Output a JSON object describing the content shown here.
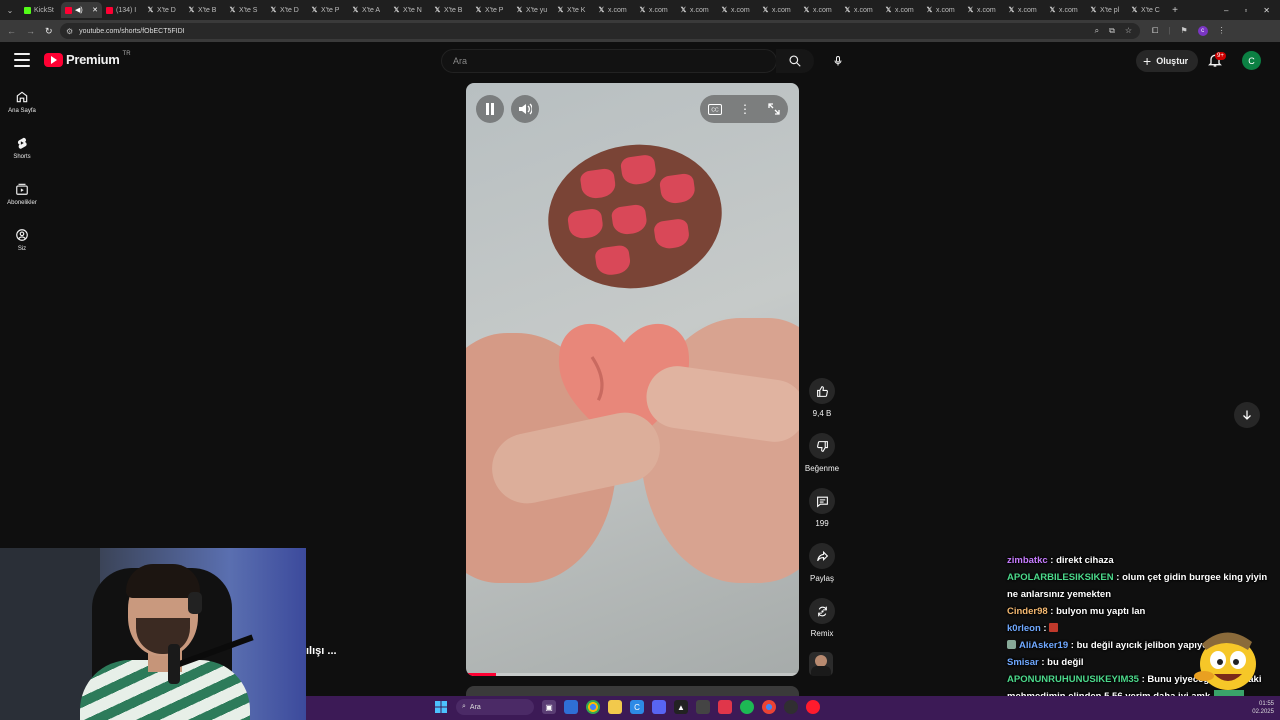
{
  "browser": {
    "tabs": [
      {
        "title": "KickSt",
        "icon": "kick",
        "active": false
      },
      {
        "title": "",
        "icon": "youtube",
        "active": true
      },
      {
        "title": "(134) I",
        "icon": "youtube",
        "active": false
      },
      {
        "title": "X'te D",
        "icon": "x",
        "active": false
      },
      {
        "title": "X'te B",
        "icon": "x",
        "active": false
      },
      {
        "title": "X'te S",
        "icon": "x",
        "active": false
      },
      {
        "title": "X'te D",
        "icon": "x",
        "active": false
      },
      {
        "title": "X'te P",
        "icon": "x",
        "active": false
      },
      {
        "title": "X'te A",
        "icon": "x",
        "active": false
      },
      {
        "title": "X'te N",
        "icon": "x",
        "active": false
      },
      {
        "title": "X'te B",
        "icon": "x",
        "active": false
      },
      {
        "title": "X'te P",
        "icon": "x",
        "active": false
      },
      {
        "title": "X'te yu",
        "icon": "x",
        "active": false
      },
      {
        "title": "X'te K",
        "icon": "x",
        "active": false
      },
      {
        "title": "x.com",
        "icon": "x",
        "active": false
      },
      {
        "title": "x.com",
        "icon": "x",
        "active": false
      },
      {
        "title": "x.com",
        "icon": "x",
        "active": false
      },
      {
        "title": "x.com",
        "icon": "x",
        "active": false
      },
      {
        "title": "x.com",
        "icon": "x",
        "active": false
      },
      {
        "title": "x.com",
        "icon": "x",
        "active": false
      },
      {
        "title": "x.com",
        "icon": "x",
        "active": false
      },
      {
        "title": "x.com",
        "icon": "x",
        "active": false
      },
      {
        "title": "x.com",
        "icon": "x",
        "active": false
      },
      {
        "title": "x.com",
        "icon": "x",
        "active": false
      },
      {
        "title": "x.com",
        "icon": "x",
        "active": false
      },
      {
        "title": "x.com",
        "icon": "x",
        "active": false
      },
      {
        "title": "X'te pl",
        "icon": "x",
        "active": false
      },
      {
        "title": "X'te C",
        "icon": "x",
        "active": false
      }
    ],
    "url": "youtube.com/shorts/fObECT5FIDI",
    "profile_initial": "c"
  },
  "header": {
    "logo_text": "Premium",
    "logo_region": "TR",
    "search_placeholder": "Ara",
    "create_label": "Oluştur",
    "notification_count": "9+",
    "avatar_initial": "C",
    "accent": "#ff0033"
  },
  "sidebar": {
    "items": [
      {
        "label": "Ana Sayfa",
        "icon": "home-icon"
      },
      {
        "label": "Shorts",
        "icon": "shorts-icon"
      },
      {
        "label": "Abonelikler",
        "icon": "subscriptions-icon"
      },
      {
        "label": "Siz",
        "icon": "you-icon"
      }
    ]
  },
  "short": {
    "progress": 0.09,
    "actions": {
      "like_count": "9,4 B",
      "dislike_label": "Beğenme",
      "comment_count": "199",
      "share_label": "Paylaş",
      "remix_label": "Remix"
    }
  },
  "overlay": {
    "caption_fragment": "ılışı ..."
  },
  "chat": {
    "messages": [
      {
        "user": "zimbatkc",
        "color": "#c77dff",
        "text": "direkt cihaza",
        "badge": false,
        "emote": false
      },
      {
        "user": "APOLARBILESIKSIKEN",
        "color": "#4cd98b",
        "text": "olum çet gidin burgee king yiyin ne anlarsınız yemekten",
        "badge": false,
        "emote": false
      },
      {
        "user": "Cinder98",
        "color": "#f5b971",
        "text": "bulyon mu yaptı lan",
        "badge": false,
        "emote": false
      },
      {
        "user": "k0rleon",
        "color": "#6fa8ff",
        "text": "",
        "badge": false,
        "emote": true
      },
      {
        "user": "AliAsker19",
        "color": "#6fa8ff",
        "text": "bu değil ayıcık jelibon yapıyo",
        "badge": true,
        "emote": false
      },
      {
        "user": "Smisar",
        "color": "#6fa8ff",
        "text": "bu değil",
        "badge": false,
        "emote": false
      },
      {
        "user": "APONUNRUHUNUSIKEYIM35",
        "color": "#4cd98b",
        "text": "Bunu yiyeceğime iraktaki mehmedimin elinden 5,56 yerim daha iyi amk",
        "badge": false,
        "emote": false
      }
    ]
  },
  "taskbar": {
    "search_label": "Ara",
    "tray_time": "01:55",
    "tray_date": "02.2025"
  }
}
